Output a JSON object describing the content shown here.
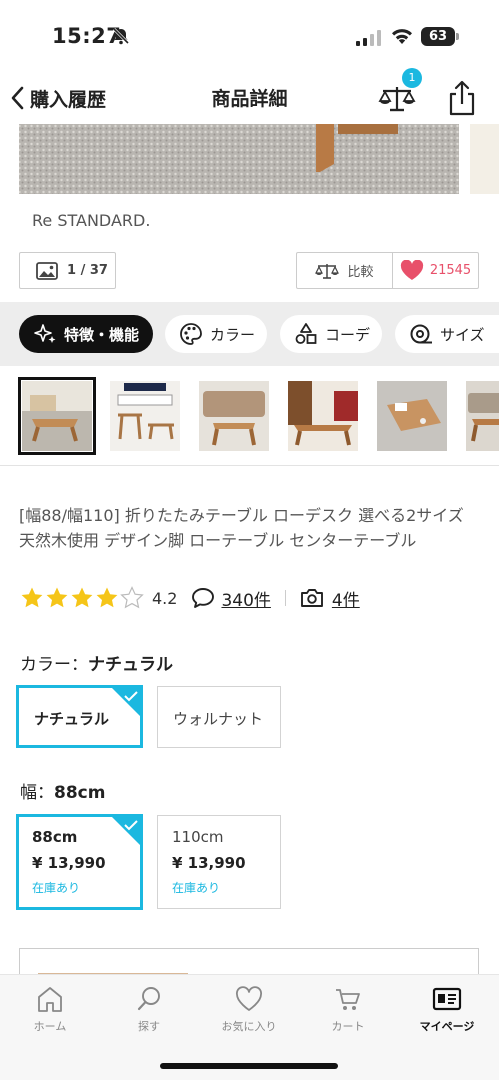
{
  "status": {
    "time": "15:27",
    "battery": "63"
  },
  "nav": {
    "back_label": "購入履歴",
    "title": "商品詳細",
    "compare_badge": "1"
  },
  "brand": "Re STANDARD.",
  "image_count": "1 / 37",
  "actions": {
    "compare_label": "比較",
    "favorite_count": "21545"
  },
  "tabs": [
    {
      "label": "特徴・機能",
      "icon": "sparkle-icon",
      "active": true
    },
    {
      "label": "カラー",
      "icon": "palette-icon"
    },
    {
      "label": "コーデ",
      "icon": "shapes-icon"
    },
    {
      "label": "サイズ",
      "icon": "tape-measure-icon"
    }
  ],
  "product": {
    "title": "[幅88/幅110] 折りたたみテーブル ローデスク 選べる2サイズ 天然木使用 デザイン脚 ローテーブル センターテーブル",
    "rating": 4.2,
    "rating_text": "4.2",
    "review_count": "340件",
    "photo_count": "4件"
  },
  "color_option": {
    "label": "カラー：",
    "selected": "ナチュラル",
    "options": [
      "ナチュラル",
      "ウォルナット"
    ]
  },
  "width_option": {
    "label": "幅：",
    "selected": "88cm",
    "options": [
      {
        "name": "88cm",
        "price": "¥ 13,990",
        "stock": "在庫あり"
      },
      {
        "name": "110cm",
        "price": "¥ 13,990",
        "stock": "在庫あり"
      }
    ]
  },
  "tabbar": [
    {
      "label": "ホーム",
      "icon": "home-icon"
    },
    {
      "label": "探す",
      "icon": "search-icon"
    },
    {
      "label": "お気に入り",
      "icon": "heart-icon"
    },
    {
      "label": "カート",
      "icon": "cart-icon"
    },
    {
      "label": "マイページ",
      "icon": "member-card-icon",
      "active": true
    }
  ],
  "colors": {
    "accent": "#1bb8e0",
    "favorite": "#e8506a",
    "star": "#f5c518"
  }
}
